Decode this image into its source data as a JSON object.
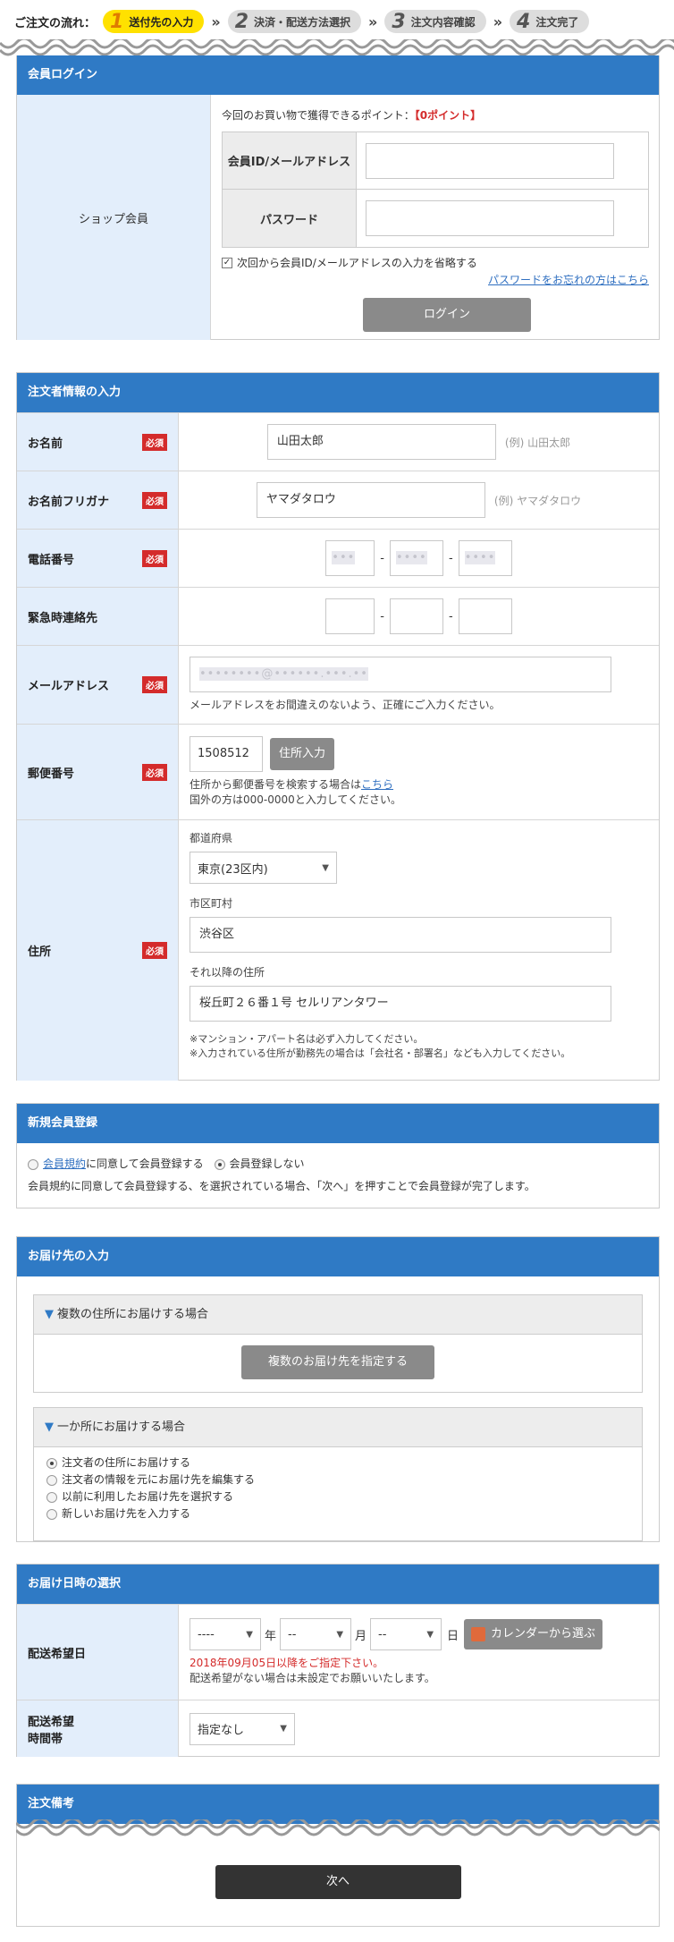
{
  "flow": {
    "label": "ご注文の流れ：",
    "steps": [
      {
        "num": "1",
        "label": "送付先の入力"
      },
      {
        "num": "2",
        "label": "決済・配送方法選択"
      },
      {
        "num": "3",
        "label": "注文内容確認"
      },
      {
        "num": "4",
        "label": "注文完了"
      }
    ],
    "chevron": "»"
  },
  "login": {
    "title": "会員ログイン",
    "shop_member": "ショップ会員",
    "points_text": "今回のお買い物で獲得できるポイント：",
    "points_value": "【0ポイント】",
    "id_label": "会員ID/メールアドレス",
    "password_label": "パスワード",
    "remember_label": "次回から会員ID/メールアドレスの入力を省略する",
    "forgot_link": "パスワードをお忘れの方はこちら",
    "login_button": "ログイン"
  },
  "orderer": {
    "title": "注文者情報の入力",
    "required": "必須",
    "name_label": "お名前",
    "name_value": "山田太郎",
    "name_example": "(例) 山田太郎",
    "kana_label": "お名前フリガナ",
    "kana_value": "ヤマダタロウ",
    "kana_example": "(例) ヤマダタロウ",
    "phone_label": "電話番号",
    "phone_parts": [
      "•••",
      "••••",
      "••••"
    ],
    "emergency_label": "緊急時連絡先",
    "dash": "-",
    "email_label": "メールアドレス",
    "email_value": "••••••••@••••••.•••.••",
    "email_hint": "メールアドレスをお間違えのないよう、正確にご入力ください。",
    "zip_label": "郵便番号",
    "zip_value": "1508512",
    "zip_button": "住所入力",
    "zip_hint_pre": "住所から郵便番号を検索する場合は",
    "zip_hint_link": "こちら",
    "zip_hint_2": "国外の方は000-0000と入力してください。",
    "address_label": "住所",
    "pref_label": "都道府県",
    "pref_value": "東京(23区内)",
    "city_label": "市区町村",
    "city_value": "渋谷区",
    "street_label": "それ以降の住所",
    "street_value": "桜丘町２６番１号 セルリアンタワー",
    "addr_note_1": "※マンション・アパート名は必ず入力してください。",
    "addr_note_2": "※入力されている住所が勤務先の場合は「会社名・部署名」なども入力してください。"
  },
  "register": {
    "title": "新規会員登録",
    "terms_link": "会員規約",
    "agree_suffix": "に同意して会員登録する",
    "no_register": "会員登録しない",
    "note": "会員規約に同意して会員登録する、を選択されている場合、「次へ」を押すことで会員登録が完了します。"
  },
  "delivery": {
    "title": "お届け先の入力",
    "multi_head": "複数の住所にお届けする場合",
    "multi_button": "複数のお届け先を指定する",
    "single_head": "一か所にお届けする場合",
    "options": [
      "注文者の住所にお届けする",
      "注文者の情報を元にお届け先を編集する",
      "以前に利用したお届け先を選択する",
      "新しいお届け先を入力する"
    ]
  },
  "datetime": {
    "title": "お届け日時の選択",
    "date_label": "配送希望日",
    "year_value": "----",
    "year_unit": "年",
    "month_value": "--",
    "month_unit": "月",
    "day_value": "--",
    "day_unit": "日",
    "calendar_button": "カレンダーから選ぶ",
    "date_warning": "2018年09月05日以降をご指定下さい。",
    "date_note": "配送希望がない場合は未設定でお願いいたします。",
    "time_label_1": "配送希望",
    "time_label_2": "時間帯",
    "time_value": "指定なし"
  },
  "remarks": {
    "title": "注文備考",
    "next_button": "次へ"
  },
  "colors": {
    "primary": "#2f7ac5",
    "label_bg": "#e3eefb",
    "required": "#d42b2b",
    "step_active": "#ffe100"
  }
}
